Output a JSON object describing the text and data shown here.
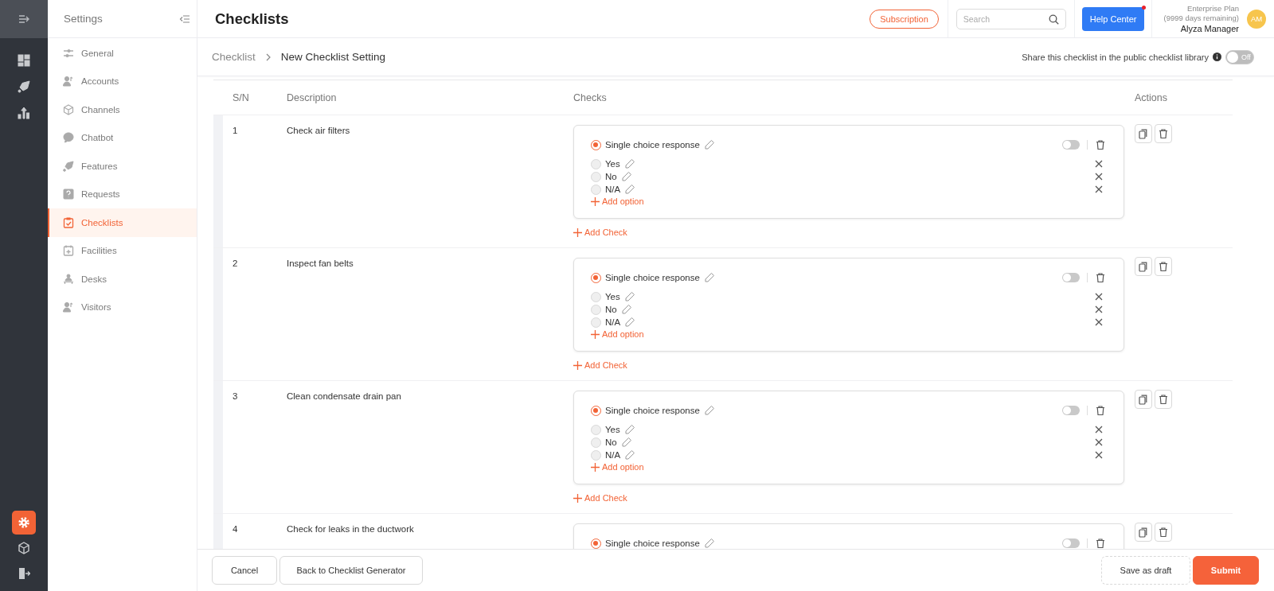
{
  "rail": {
    "top_items": [
      {
        "selected": false
      },
      {
        "selected": false
      },
      {
        "selected": false
      }
    ],
    "bottom_items": [
      {
        "selected": true
      },
      {
        "selected": false
      },
      {
        "selected": false
      }
    ]
  },
  "settings_nav": {
    "title": "Settings",
    "items": [
      {
        "label": "General",
        "selected": false
      },
      {
        "label": "Accounts",
        "selected": false
      },
      {
        "label": "Channels",
        "selected": false
      },
      {
        "label": "Chatbot",
        "selected": false
      },
      {
        "label": "Features",
        "selected": false
      },
      {
        "label": "Requests",
        "selected": false
      },
      {
        "label": "Checklists",
        "selected": true
      },
      {
        "label": "Facilities",
        "selected": false
      },
      {
        "label": "Desks",
        "selected": false
      },
      {
        "label": "Visitors",
        "selected": false
      }
    ]
  },
  "header": {
    "title": "Checklists",
    "subscription": "Subscription",
    "search": {
      "placeholder": "Search"
    },
    "help_center": {
      "label": "Help Center",
      "notification": true
    },
    "plan": "Enterprise Plan",
    "days_remaining": "(9999 days remaining)",
    "user_name": "Alyza Manager",
    "avatar_initials": "AM"
  },
  "breadcrumb": [
    {
      "label": "Checklist",
      "current": false
    },
    {
      "label": "New Checklist Setting",
      "current": true
    }
  ],
  "share": {
    "label": "Share this checklist in the public checklist library",
    "on": false,
    "toggle_label": "Off"
  },
  "table": {
    "columns": [
      "S/N",
      "Description",
      "Checks",
      "Actions"
    ],
    "rows": [
      {
        "sn": "1",
        "description": "Check air filters",
        "checks": [
          {
            "response_type": "Single choice response",
            "selected": true,
            "required": false,
            "options": [
              {
                "label": "Yes",
                "selected": false
              },
              {
                "label": "No",
                "selected": false
              },
              {
                "label": "N/A",
                "selected": false
              }
            ],
            "add_option": "Add option"
          }
        ],
        "add_check": "Add Check"
      },
      {
        "sn": "2",
        "description": "Inspect fan belts",
        "checks": [
          {
            "response_type": "Single choice response",
            "selected": true,
            "required": false,
            "options": [
              {
                "label": "Yes",
                "selected": false
              },
              {
                "label": "No",
                "selected": false
              },
              {
                "label": "N/A",
                "selected": false
              }
            ],
            "add_option": "Add option"
          }
        ],
        "add_check": "Add Check"
      },
      {
        "sn": "3",
        "description": "Clean condensate drain pan",
        "checks": [
          {
            "response_type": "Single choice response",
            "selected": true,
            "required": false,
            "options": [
              {
                "label": "Yes",
                "selected": false
              },
              {
                "label": "No",
                "selected": false
              },
              {
                "label": "N/A",
                "selected": false
              }
            ],
            "add_option": "Add option"
          }
        ],
        "add_check": "Add Check"
      },
      {
        "sn": "4",
        "description": "Check for leaks in the ductwork",
        "checks": [
          {
            "response_type": "Single choice response",
            "selected": true,
            "required": false
          }
        ]
      }
    ]
  },
  "footer": {
    "cancel": "Cancel",
    "back": "Back to Checklist Generator",
    "save_draft": "Save as draft",
    "submit": "Submit"
  }
}
